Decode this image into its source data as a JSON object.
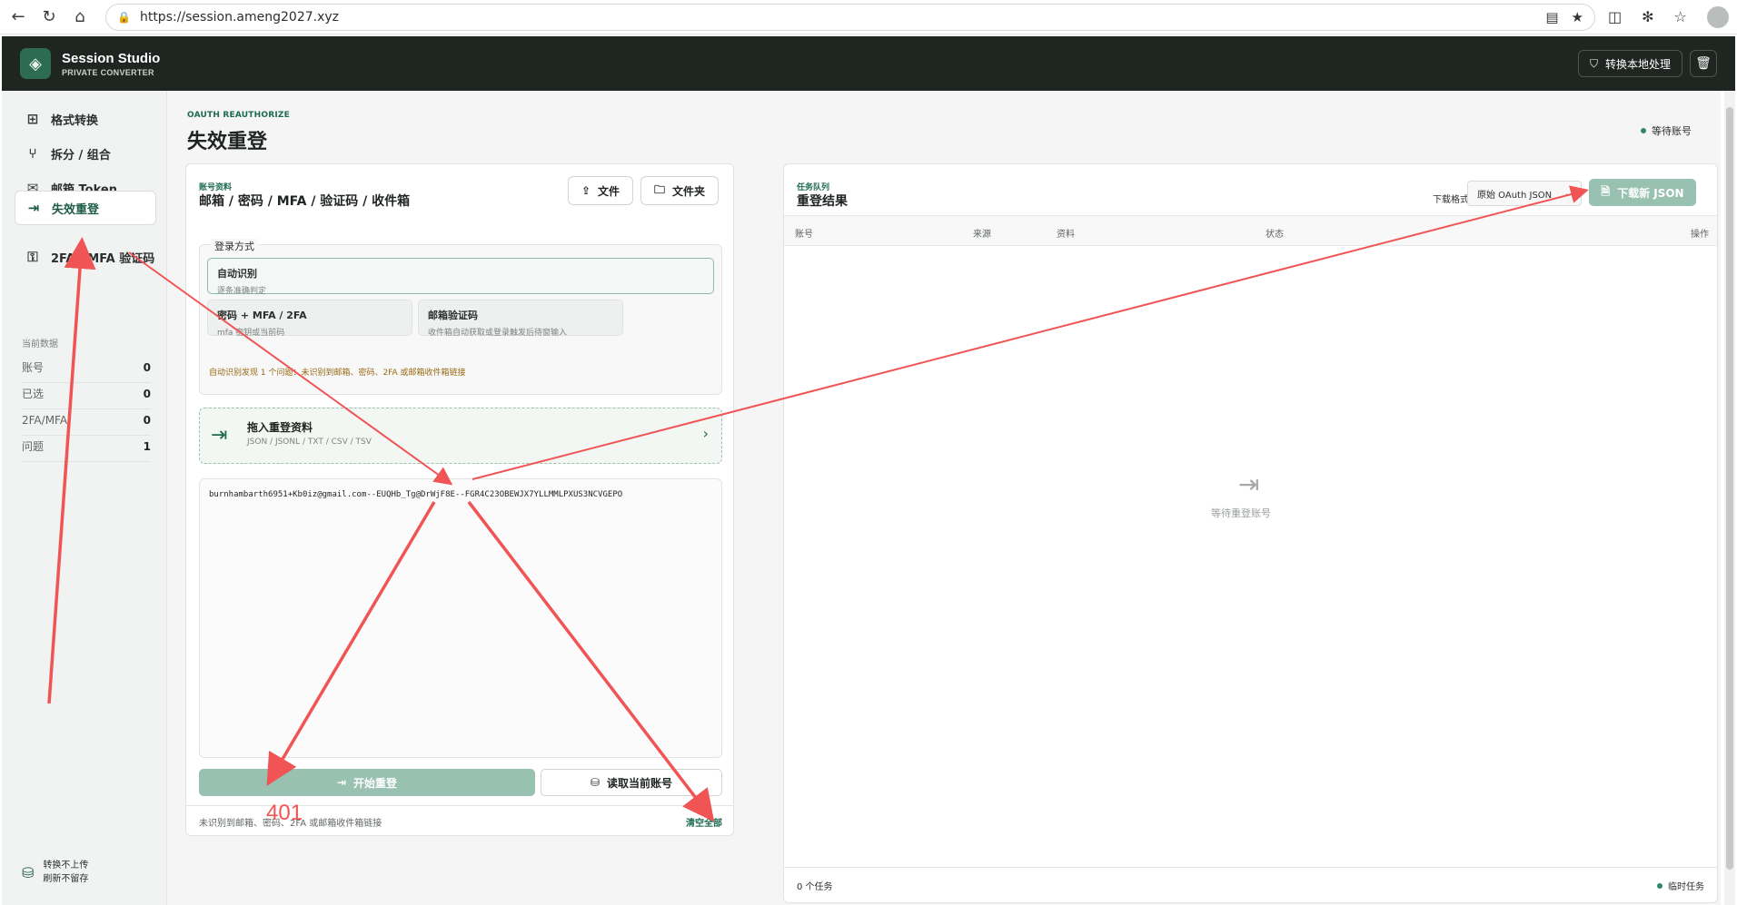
{
  "browser": {
    "url": "https://session.ameng2027.xyz"
  },
  "header": {
    "brand_name": "Session Studio",
    "brand_sub": "PRIVATE CONVERTER",
    "local_button": "转换本地处理"
  },
  "sidebar": {
    "items": [
      {
        "label": "格式转换"
      },
      {
        "label": "拆分 / 组合"
      },
      {
        "label": "邮箱 Token"
      },
      {
        "label": "失效重登"
      },
      {
        "label": "2FA / MFA 验证码"
      }
    ],
    "stats_title": "当前数据",
    "stats": [
      {
        "label": "账号",
        "value": "0"
      },
      {
        "label": "已选",
        "value": "0"
      },
      {
        "label": "2FA/MFA",
        "value": "0"
      },
      {
        "label": "问题",
        "value": "1"
      }
    ],
    "footer_line1": "转换不上传",
    "footer_line2": "刷新不留存"
  },
  "page": {
    "eyebrow": "OAUTH REAUTHORIZE",
    "title": "失效重登",
    "wait_status": "等待账号"
  },
  "left_panel": {
    "eyebrow": "账号资料",
    "title": "邮箱 / 密码 / MFA / 验证码 / 收件箱",
    "file_button": "文件",
    "folder_button": "文件夹",
    "login_legend": "登录方式",
    "modes": [
      {
        "title": "自动识别",
        "desc": "逐条准确判定"
      },
      {
        "title": "密码 + MFA / 2FA",
        "desc": "mfa 密钥或当前码"
      },
      {
        "title": "邮箱验证码",
        "desc": "收件箱自动获取或登录触发后待窗输入"
      }
    ],
    "hint": "自动识别发现 1 个问题：未识别到邮箱、密码、2FA 或邮箱收件箱链接",
    "drop_title": "拖入重登资料",
    "drop_sub": "JSON / JSONL / TXT / CSV / TSV",
    "textarea_value": "burnhambarth6951+Kb0iz@gmail.com--EUQHb_Tg@DrWjF8E--FGR4C23OBEWJX7YLLMMLPXUS3NCVGEPO",
    "start_button": "开始重登",
    "read_button": "读取当前账号",
    "footer_status": "未识别到邮箱、密码、2FA 或邮箱收件箱链接",
    "clear_all": "清空全部"
  },
  "right_panel": {
    "eyebrow": "任务队列",
    "title": "重登结果",
    "format_label": "下载格式",
    "format_value": "原始 OAuth JSON",
    "download_button": "下载新 JSON",
    "columns": [
      "账号",
      "来源",
      "资料",
      "状态",
      "操作"
    ],
    "empty_text": "等待重登账号",
    "task_count": "0 个任务",
    "temp_task": "临时任务"
  },
  "annotation": {
    "label": "401",
    "color": "#f05454"
  }
}
